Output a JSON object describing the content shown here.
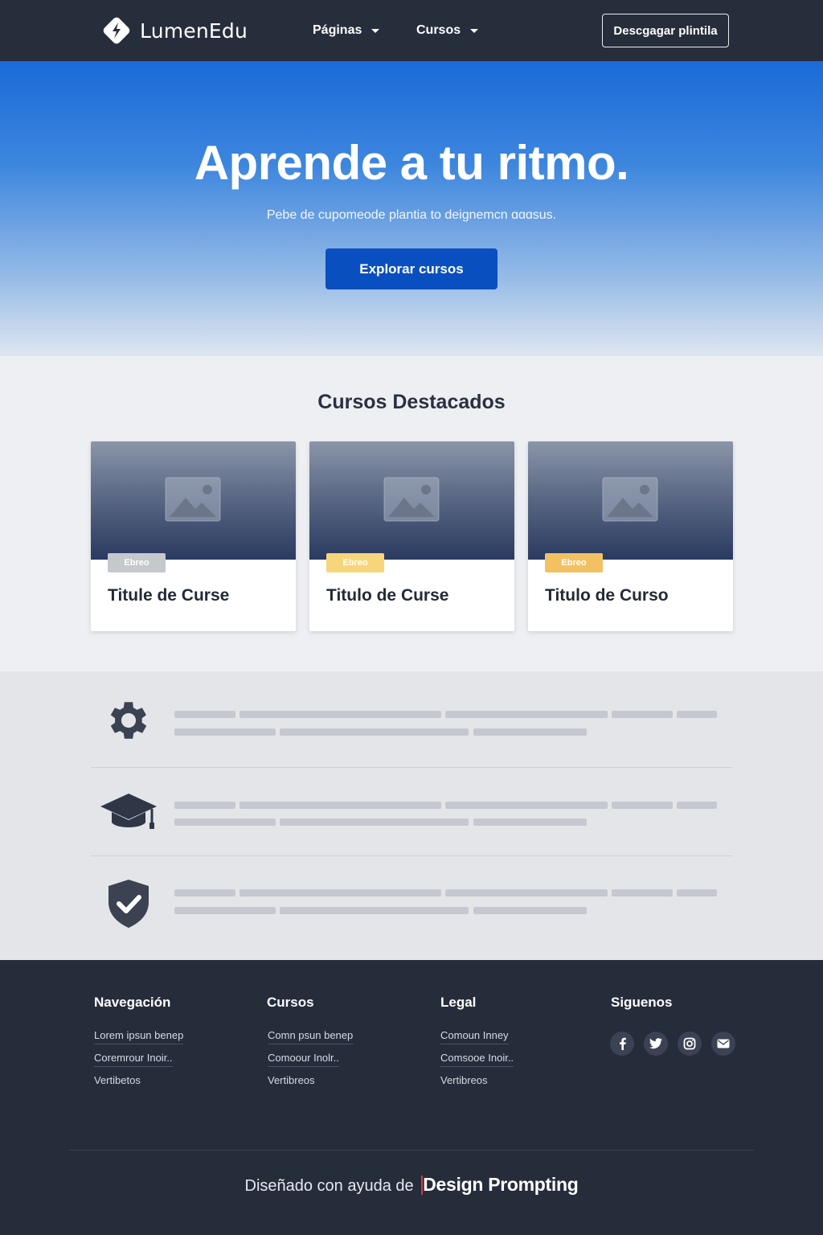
{
  "navbar": {
    "brand_name": "LumenEdu",
    "nav_paginas": "Páginas",
    "nav_cursos": "Cursos",
    "download_label": "Descgagar plintila"
  },
  "hero": {
    "title": "Aprende a tu ritmo.",
    "subtitle": "Pebe de cupomeode plantia to deignemcn ɑɑɑsus.",
    "cta_label": "Explorar cursos"
  },
  "featured": {
    "title": "Cursos Destacados",
    "cards": [
      {
        "badge": "Ebreo",
        "title": "Titule de Curse",
        "badge_color": "#c5c8cd"
      },
      {
        "badge": "Ebreo",
        "title": "Titulo de Curse",
        "badge_color": "#f7d57a"
      },
      {
        "badge": "Ebreo",
        "title": "Titulo de Curso",
        "badge_color": "#f3c162"
      }
    ]
  },
  "features": [
    {
      "icon": "gear-icon"
    },
    {
      "icon": "graduation-cap-icon"
    },
    {
      "icon": "shield-check-icon"
    }
  ],
  "footer": {
    "nav_title": "Navegación",
    "nav_links": [
      "Lorem ipsun benep",
      "Coremrour Inoir..",
      "Vertibetos"
    ],
    "cursos_title": "Cursos",
    "cursos_links": [
      "Comn psun benep",
      "Comoour Inolr..",
      "Vertibreos"
    ],
    "legal_title": "Legal",
    "legal_links": [
      "Comoun Inney",
      "Comsooe Inoir..",
      "Vertibreos"
    ],
    "social_title": "Siguenos",
    "social_icons": [
      "facebook-icon",
      "twitter-icon",
      "instagram-icon",
      "email-icon"
    ],
    "credit_prefix": "Diseñado con ayuda de",
    "credit_brand": "Design Prompting"
  },
  "colors": {
    "navbar_bg": "#262e3c",
    "hero_top": "#1a6bd8",
    "cta_bg": "#0a4fbf",
    "footer_bg": "#252d3b"
  }
}
